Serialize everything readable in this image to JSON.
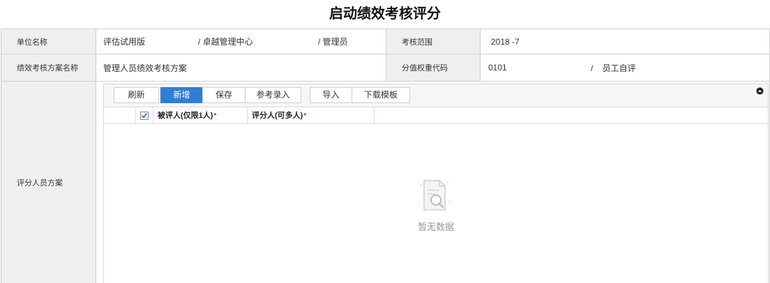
{
  "page": {
    "title": "启动绩效考核评分"
  },
  "form": {
    "unit_label": "单位名称",
    "unit_value_1": "评估试用版",
    "unit_value_2": "/ 卓越管理中心",
    "unit_value_3": "/ 管理员",
    "scope_label": "考核范围",
    "scope_value": "2018 -7",
    "plan_label": "绩效考核方案名称",
    "plan_value": "管理人员绩效考核方案",
    "weight_label": "分值权重代码",
    "weight_code": "0101",
    "weight_type": "/    员工自评",
    "scorer_plan_label": "评分人员方案"
  },
  "toolbar": {
    "refresh": "刷新",
    "add": "新增",
    "save": "保存",
    "ref_entry": "参考录入",
    "import": "导入",
    "download_template": "下载模板"
  },
  "grid": {
    "columns": [
      {
        "label": "被评人(仅限1人)",
        "required": "*"
      },
      {
        "label": "评分人(可多人)",
        "required": "*"
      }
    ],
    "empty_text": "暂无数据"
  },
  "colors": {
    "primary": "#2f7fd6",
    "label_bg": "#efefef",
    "required": "#e02020"
  }
}
